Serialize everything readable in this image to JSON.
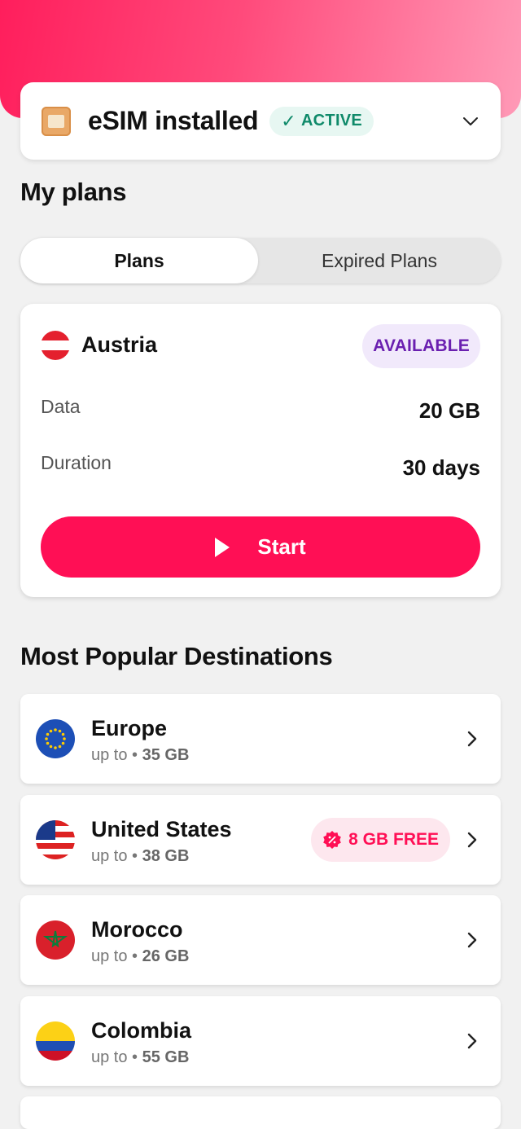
{
  "header": {
    "esim_title": "eSIM installed",
    "status_badge": "ACTIVE",
    "colors": {
      "accent": "#ff0f55",
      "active_green": "#0f8a6a"
    }
  },
  "plans_section": {
    "title": "My plans",
    "tabs": [
      {
        "label": "Plans",
        "selected": true
      },
      {
        "label": "Expired Plans",
        "selected": false
      }
    ],
    "plan": {
      "country": "Austria",
      "status": "AVAILABLE",
      "data_label": "Data",
      "data_value": "20 GB",
      "duration_label": "Duration",
      "duration_value": "30 days",
      "start_label": "Start"
    }
  },
  "popular": {
    "title": "Most Popular Destinations",
    "items": [
      {
        "name": "Europe",
        "prefix": "up to •",
        "amount": "35 GB",
        "badge": ""
      },
      {
        "name": "United States",
        "prefix": "up to •",
        "amount": "38 GB",
        "badge": "8 GB FREE"
      },
      {
        "name": "Morocco",
        "prefix": "up to •",
        "amount": "26 GB",
        "badge": ""
      },
      {
        "name": "Colombia",
        "prefix": "up to •",
        "amount": "55 GB",
        "badge": ""
      }
    ]
  }
}
